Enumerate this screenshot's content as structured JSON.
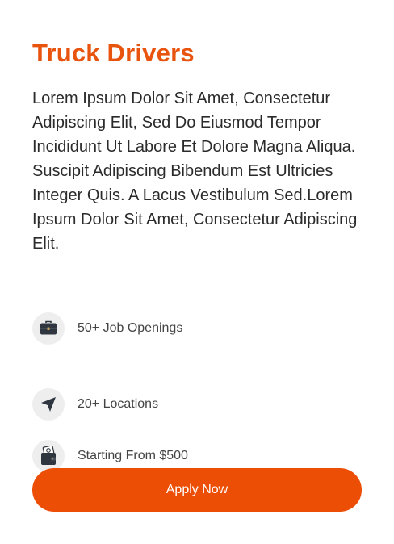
{
  "job": {
    "title": "Truck Drivers",
    "description": "Lorem Ipsum Dolor Sit Amet, Consectetur Adipiscing Elit, Sed Do Eiusmod Tempor Incididunt Ut Labore Et Dolore Magna Aliqua. Suscipit Adipiscing Bibendum Est Ultricies Integer Quis. A Lacus Vestibulum Sed.Lorem Ipsum Dolor Sit Amet, Consectetur Adipiscing Elit.",
    "features": [
      {
        "icon": "briefcase-icon",
        "label": "50+ Job Openings"
      },
      {
        "icon": "navigation-arrow-icon",
        "label": "20+ Locations"
      },
      {
        "icon": "wallet-icon",
        "label": "Starting From $500"
      }
    ],
    "apply_label": "Apply Now"
  },
  "colors": {
    "accent": "#ec4e06",
    "title": "#e8530e",
    "text": "#2b2b2b",
    "icon_bg": "#eeeeee",
    "icon_fg": "#2f3640"
  }
}
